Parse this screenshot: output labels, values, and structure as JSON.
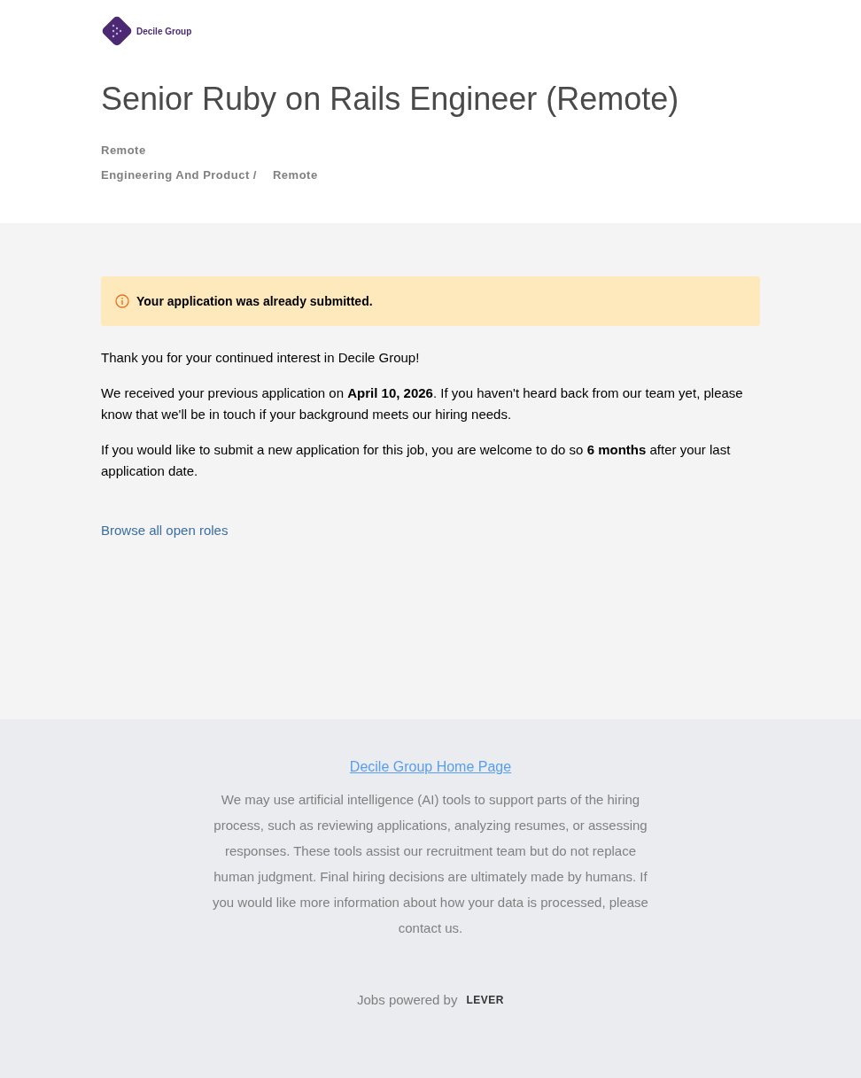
{
  "logo": {
    "text": "Decile Group"
  },
  "job": {
    "title": "Senior Ruby on Rails Engineer (Remote)",
    "location": "Remote",
    "team": "Engineering And Product /",
    "workplace": "Remote"
  },
  "alert": {
    "text": "Your application was already submitted."
  },
  "paragraphs": [
    "Thank you for your continued interest in Decile Group!",
    "We received your previous application on **April 10, 2026**. If you haven't heard back from our team yet, please know that we'll be in touch if your background meets our hiring needs.",
    "If you would like to submit a new application for this job, you are welcome to do so **6 months** after your last application date."
  ],
  "browse_link": "Browse all open roles",
  "footer": {
    "home_link": "Decile Group Home Page",
    "notice": "We may use artificial intelligence (AI) tools to support parts of the hiring process, such as reviewing applications, analyzing resumes, or assessing responses. These tools assist our recruitment team but do not replace human judgment. Final hiring decisions are ultimately made by humans. If you would like more information about how your data is processed, please contact us.",
    "powered_by": "Jobs powered by",
    "brand": "LEVER"
  }
}
